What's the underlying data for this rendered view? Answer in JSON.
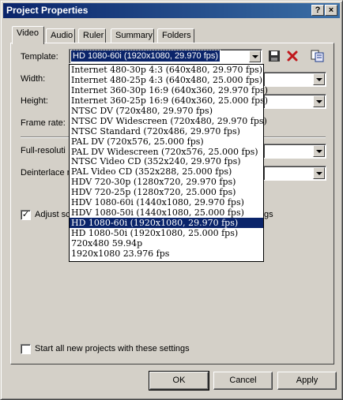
{
  "window": {
    "title": "Project Properties",
    "help_glyph": "?",
    "close_glyph": "×"
  },
  "tabs": [
    {
      "label": "Video",
      "active": true
    },
    {
      "label": "Audio"
    },
    {
      "label": "Ruler"
    },
    {
      "label": "Summary"
    },
    {
      "label": "Folders"
    }
  ],
  "form": {
    "template_label": "Template:",
    "template_value": "HD 1080-60i (1920x1080, 29.970 fps)",
    "width_label": "Width:",
    "height_label": "Height:",
    "frame_rate_label": "Frame rate:",
    "full_res_label": "Full-resoluti",
    "deinterlace_label": "Deinterlace n",
    "adjust_label": "Adjust sc",
    "adjust_tail": "gs",
    "adjust_checked": true,
    "start_all_label": "Start all new projects with these settings",
    "start_all_checked": false
  },
  "toolbar_icons": {
    "save": "save-icon",
    "delete": "delete-icon",
    "copy": "copy-settings-icon"
  },
  "template_options": [
    "Internet 480-30p 4:3 (640x480, 29.970 fps)",
    "Internet 480-25p 4:3 (640x480, 25.000 fps)",
    "Internet 360-30p 16:9 (640x360, 29.970 fps)",
    "Internet 360-25p 16:9 (640x360, 25.000 fps)",
    "NTSC DV (720x480, 29.970 fps)",
    "NTSC DV Widescreen (720x480, 29.970 fps)",
    "NTSC Standard (720x486, 29.970 fps)",
    "PAL DV (720x576, 25.000 fps)",
    "PAL DV Widescreen (720x576, 25.000 fps)",
    "NTSC Video CD (352x240, 29.970 fps)",
    "PAL Video CD (352x288, 25.000 fps)",
    "HDV 720-30p (1280x720, 29.970 fps)",
    "HDV 720-25p (1280x720, 25.000 fps)",
    "HDV 1080-60i (1440x1080, 29.970 fps)",
    "HDV 1080-50i (1440x1080, 25.000 fps)",
    "HD 1080-60i (1920x1080, 29.970 fps)",
    "HD 1080-50i (1920x1080, 25.000 fps)",
    "720x480 59.94p",
    "1920x1080 23.976 fps"
  ],
  "selected_option_index": 15,
  "buttons": {
    "ok": "OK",
    "cancel": "Cancel",
    "apply": "Apply"
  },
  "colors": {
    "title_bar": "#0a246a",
    "selection": "#0a246a",
    "face": "#d4d0c8"
  }
}
